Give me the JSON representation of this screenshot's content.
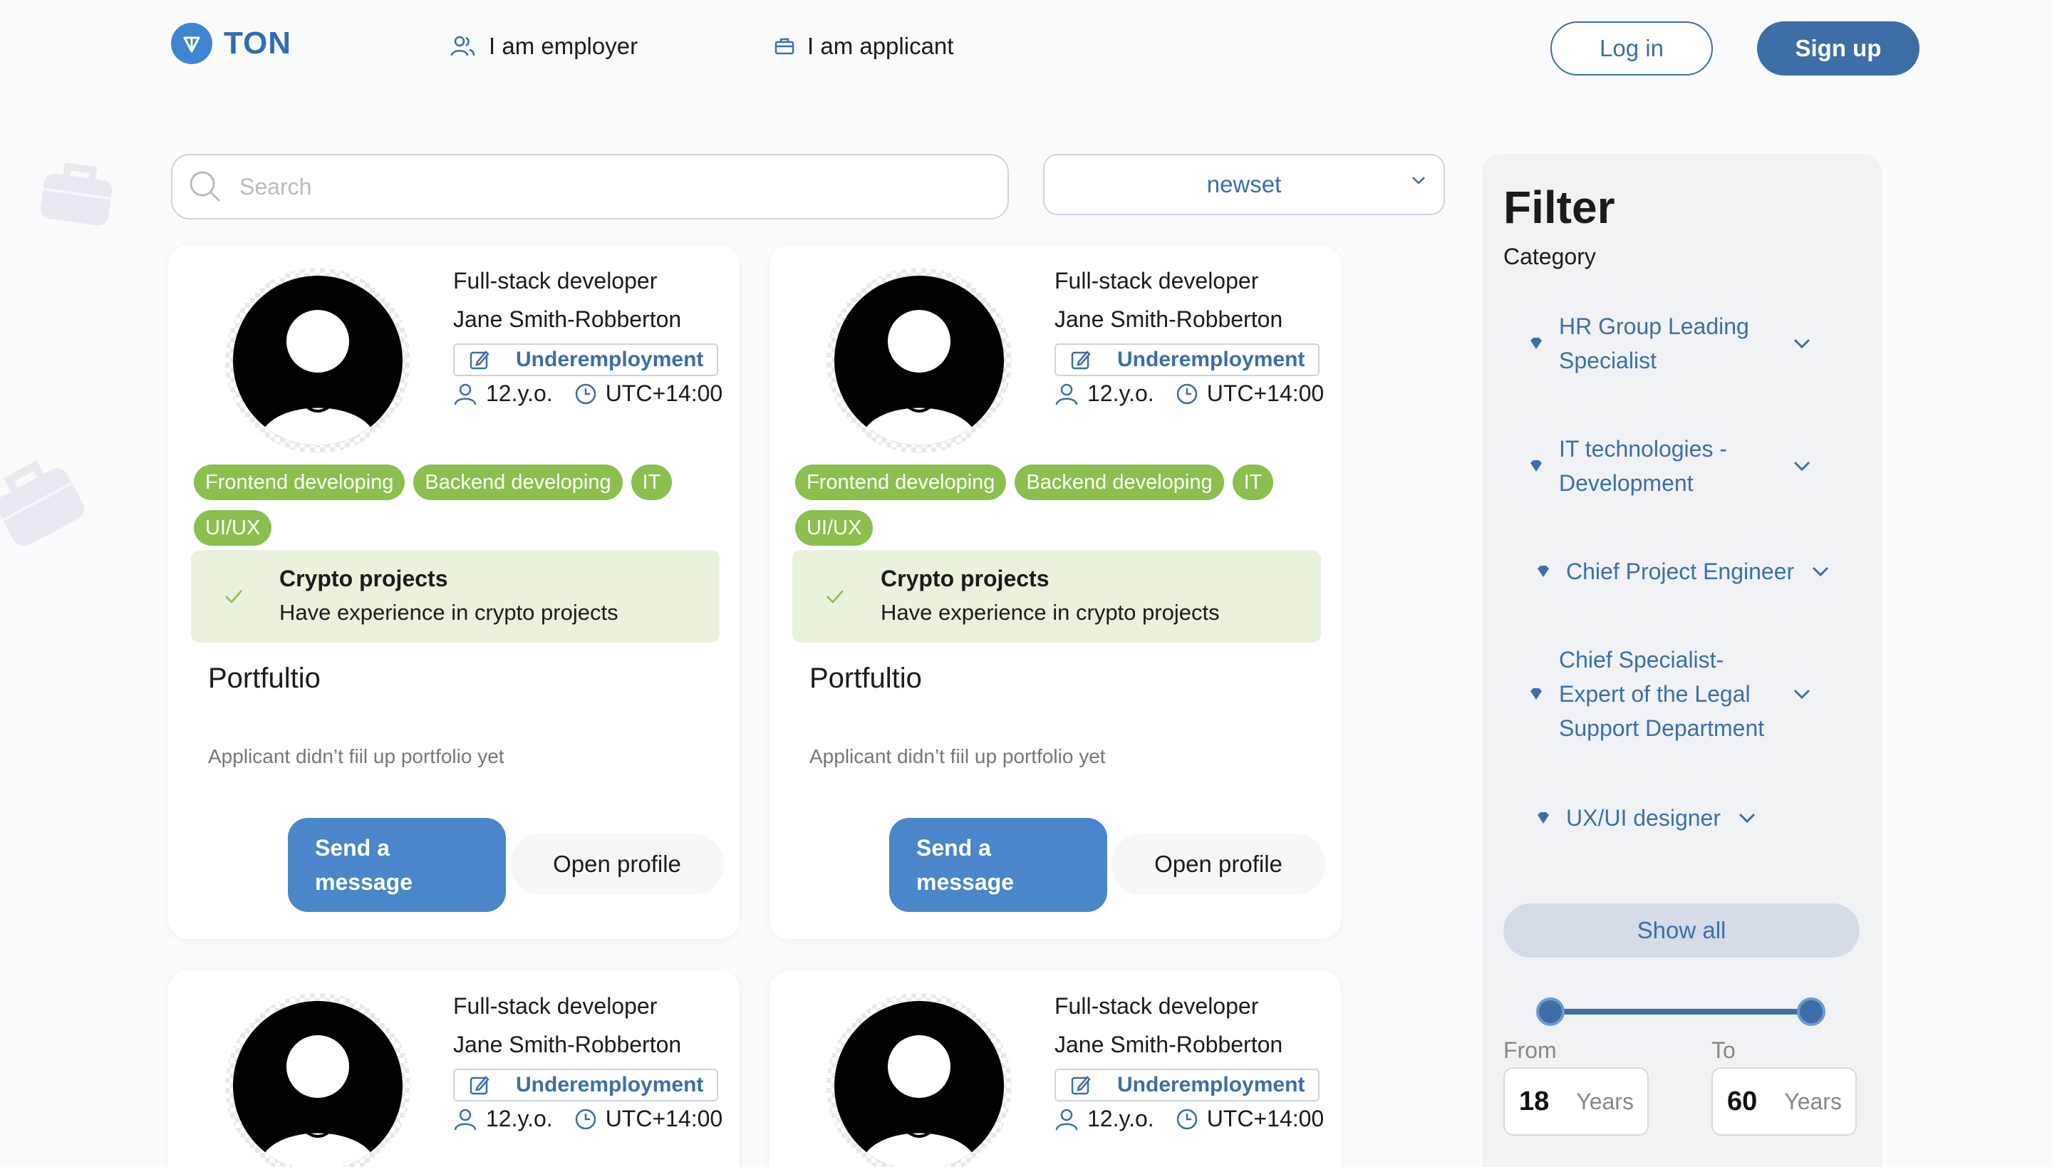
{
  "header": {
    "logo_text": "TON",
    "nav_employer": "I am employer",
    "nav_applicant": "I am applicant",
    "login_label": "Log in",
    "signup_label": "Sign up"
  },
  "search": {
    "placeholder": "Search"
  },
  "sort": {
    "selected": "newset"
  },
  "cards": [
    {
      "role": "Full-stack developer",
      "name": "Jane Smith-Robberton",
      "status": "Underemployment",
      "age": "12.y.o.",
      "timezone": "UTC+14:00",
      "tags": [
        "Frontend developing",
        "Backend developing",
        "IT",
        "UI/UX"
      ],
      "crypto_title": "Crypto projects",
      "crypto_desc": "Have experience in crypto projects",
      "portfolio_title": "Portfultio",
      "portfolio_empty": "Applicant didn’t fiil up portfolio yet",
      "message_label": "Send a message",
      "open_label": "Open profile"
    },
    {
      "role": "Full-stack developer",
      "name": "Jane Smith-Robberton",
      "status": "Underemployment",
      "age": "12.y.o.",
      "timezone": "UTC+14:00",
      "tags": [
        "Frontend developing",
        "Backend developing",
        "IT",
        "UI/UX"
      ],
      "crypto_title": "Crypto projects",
      "crypto_desc": "Have experience in crypto projects",
      "portfolio_title": "Portfultio",
      "portfolio_empty": "Applicant didn’t fiil up portfolio yet",
      "message_label": "Send a message",
      "open_label": "Open profile"
    },
    {
      "role": "Full-stack developer",
      "name": "Jane Smith-Robberton",
      "status": "Underemployment",
      "age": "12.y.o.",
      "timezone": "UTC+14:00"
    },
    {
      "role": "Full-stack developer",
      "name": "Jane Smith-Robberton",
      "status": "Underemployment",
      "age": "12.y.o.",
      "timezone": "UTC+14:00"
    }
  ],
  "filter": {
    "title": "Filter",
    "category_label": "Category",
    "categories": [
      "HR Group Leading Specialist",
      "IT technologies - Development",
      "Chief Project Engineer",
      "Chief Specialist-Expert of the Legal Support Department",
      "UX/UI designer"
    ],
    "show_all_label": "Show all",
    "from_label": "From",
    "to_label": "To",
    "from_value": "18",
    "to_value": "60",
    "unit": "Years"
  },
  "colors": {
    "accent": "#3d6ea8",
    "tag_green": "#8cbf4e",
    "crypto_bg": "#e8f2dc"
  }
}
